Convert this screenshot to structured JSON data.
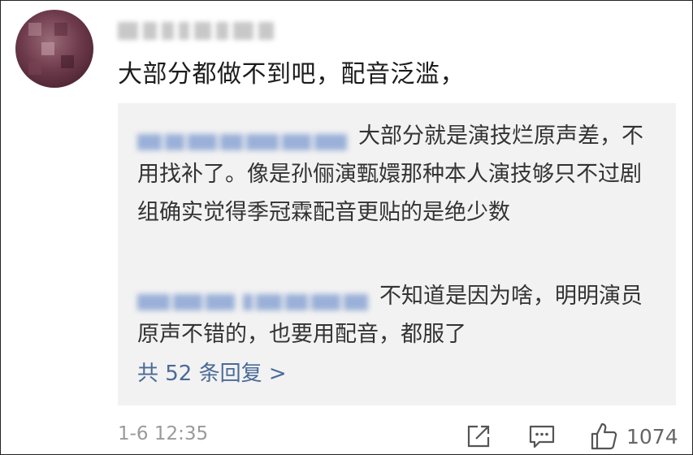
{
  "comment": {
    "username_blurred": "",
    "text": "大部分都做不到吧，配音泛滥，"
  },
  "replies": [
    {
      "text": "大部分就是演技烂原声差，不用找补了。像是孙俪演甄嬛那种本人演技够只不过剧组确实觉得季冠霖配音更贴的是绝少数"
    },
    {
      "text": "不知道是因为啥，明明演员原声不错的，也要用配音，都服了"
    }
  ],
  "more_replies_label": "共 52 条回复 >",
  "footer": {
    "timestamp": "1-6 12:35",
    "like_count": "1074"
  },
  "icons": {
    "share": "share-icon",
    "comment": "comment-icon",
    "like": "thumbs-up-icon"
  },
  "colors": {
    "link": "#4a6a98",
    "reply_bg": "#f2f2f2",
    "meta_text": "#9a9a9a"
  }
}
